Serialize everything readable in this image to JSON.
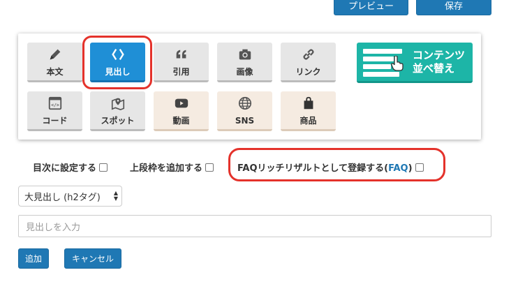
{
  "toolbar": {
    "preview_label": "プレビュー",
    "save_label": "保存"
  },
  "palette": {
    "row1": [
      {
        "label": "本文",
        "icon": "pencil-icon",
        "style": "gray"
      },
      {
        "label": "見出し",
        "icon": "code-brackets-icon",
        "style": "blue",
        "selected": true
      },
      {
        "label": "引用",
        "icon": "quote-icon",
        "style": "gray"
      },
      {
        "label": "画像",
        "icon": "camera-icon",
        "style": "gray"
      },
      {
        "label": "リンク",
        "icon": "link-icon",
        "style": "gray"
      }
    ],
    "row2": [
      {
        "label": "コード",
        "icon": "code-window-icon",
        "style": "gray"
      },
      {
        "label": "スポット",
        "icon": "map-pin-icon",
        "style": "gray"
      },
      {
        "label": "動画",
        "icon": "youtube-icon",
        "style": "beige"
      },
      {
        "label": "SNS",
        "icon": "globe-icon",
        "style": "beige"
      },
      {
        "label": "商品",
        "icon": "shopping-bag-icon",
        "style": "beige"
      }
    ],
    "reorder": {
      "line1": "コンテンツ",
      "line2": "並べ替え"
    }
  },
  "options": {
    "toc_label": "目次に設定する",
    "border_label": "上段枠を追加する",
    "faq_label": "FAQリッチリザルトとして登録する(",
    "faq_link": "FAQ",
    "faq_close": ")"
  },
  "heading_select": {
    "value": "大見出し (h2タグ)"
  },
  "heading_input": {
    "placeholder": "見出しを入力"
  },
  "actions": {
    "add_label": "追加",
    "cancel_label": "キャンセル"
  },
  "colors": {
    "accent": "#1f78b4",
    "tile_blue": "#1f8fd6",
    "teal": "#1db5a7",
    "highlight": "#e4322b"
  }
}
